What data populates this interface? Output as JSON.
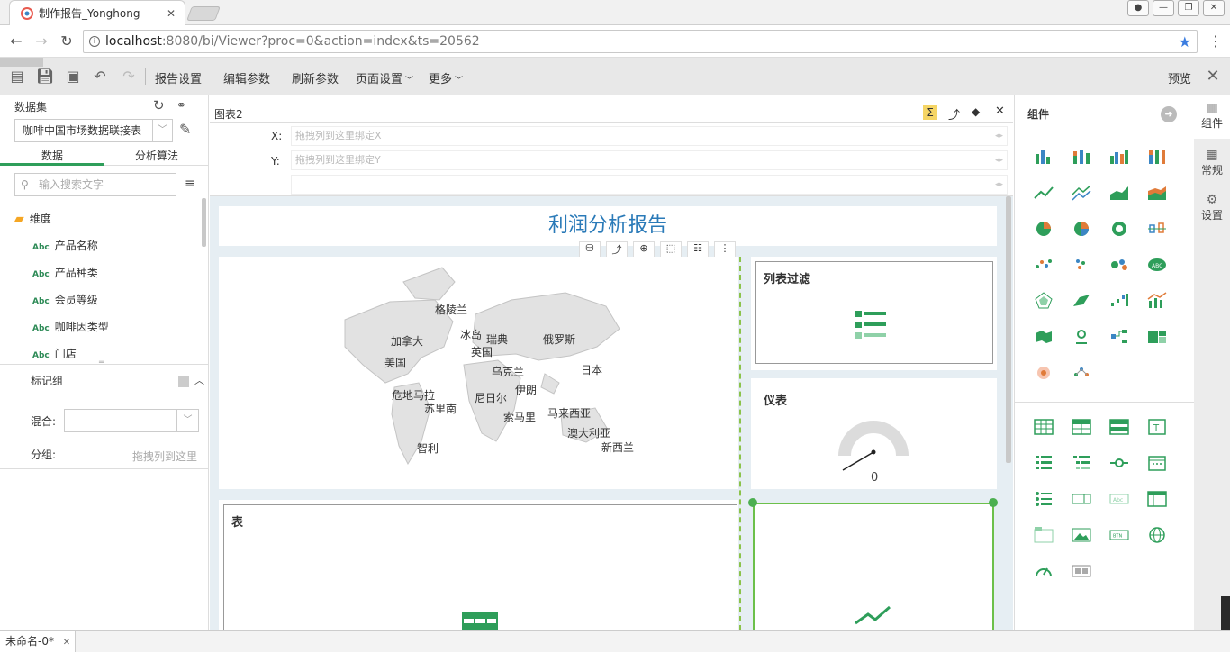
{
  "browser": {
    "tab_title": "制作报告_Yonghong",
    "tab_close": "✕",
    "url_host": "localhost",
    "url_path": ":8080/bi/Viewer?proc=0&action=index&ts=20562"
  },
  "toolbar": {
    "report_settings": "报告设置",
    "edit_params": "编辑参数",
    "refresh_params": "刷新参数",
    "page_settings": "页面设置",
    "more": "更多",
    "preview": "预览"
  },
  "left": {
    "dataset_label": "数据集",
    "dataset_value": "咖啡中国市场数据联接表",
    "tab_data": "数据",
    "tab_algo": "分析算法",
    "search_placeholder": "输入搜索文字",
    "dimension_label": "维度",
    "fields": [
      "产品名称",
      "产品种类",
      "会员等级",
      "咖啡因类型",
      "门店"
    ],
    "field_tag": "Abc",
    "mark_group": "标记组",
    "mix_label": "混合:",
    "group_label": "分组:",
    "group_hint": "拖拽列到这里"
  },
  "chartpanel": {
    "title": "图表2",
    "x_label": "X:",
    "x_hint": "拖拽列到这里绑定X",
    "y_label": "Y:",
    "y_hint": "拖拽列到这里绑定Y"
  },
  "canvas": {
    "report_title": "利润分析报告",
    "map_labels": [
      "格陵兰",
      "加拿大",
      "冰岛",
      "瑞典",
      "英国",
      "俄罗斯",
      "美国",
      "乌克兰",
      "日本",
      "伊朗",
      "危地马拉",
      "尼日尔",
      "苏里南",
      "马来西亚",
      "索马里",
      "澳大利亚",
      "新西兰",
      "智利"
    ],
    "list_filter_title": "列表过滤",
    "gauge_title": "仪表",
    "gauge_value": "0",
    "table_title": "表"
  },
  "right": {
    "components_title": "组件",
    "side_components": "组件",
    "side_general": "常规",
    "side_settings": "设置"
  },
  "status": {
    "doc_tab": "未命名-0*",
    "doc_close": "✕"
  },
  "colors": {
    "accent_green": "#2e9e5a",
    "title_blue": "#2a7ab8",
    "chart_orange": "#e07b39",
    "chart_blue": "#3b86c4"
  }
}
